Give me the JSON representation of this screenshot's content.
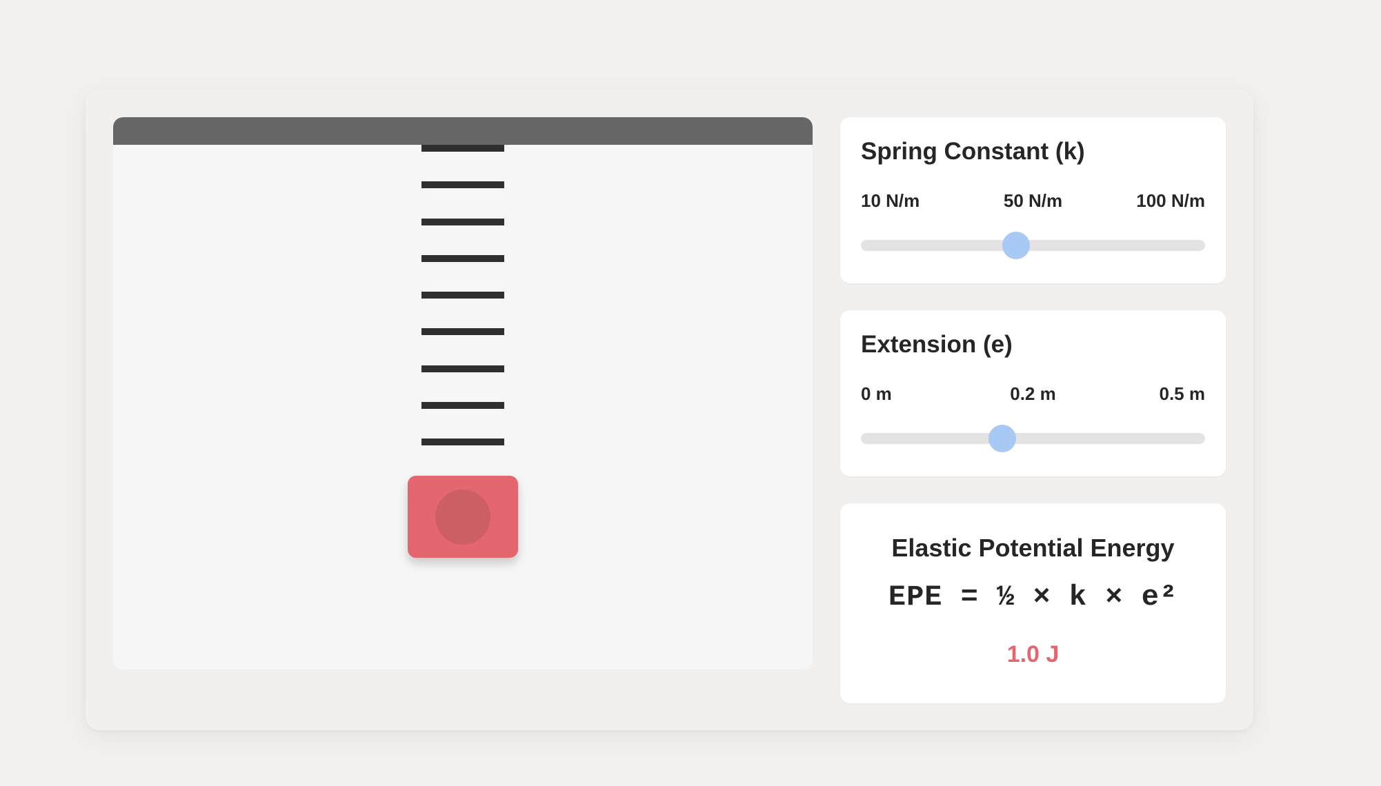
{
  "spring_constant": {
    "title": "Spring Constant (k)",
    "min_label": "10 N/m",
    "mid_label": "50 N/m",
    "max_label": "100 N/m",
    "value_fraction": 0.45
  },
  "extension": {
    "title": "Extension (e)",
    "min_label": "0 m",
    "mid_label": "0.2 m",
    "max_label": "0.5 m",
    "value_fraction": 0.41
  },
  "energy": {
    "title": "Elastic Potential Energy",
    "formula": "EPE = ½ × k × e²",
    "value": "1.0 J"
  },
  "colors": {
    "mass": "#e4666f",
    "slider_thumb": "#a9c9f5",
    "ceiling": "#666666",
    "spring": "#2f2f2f"
  }
}
